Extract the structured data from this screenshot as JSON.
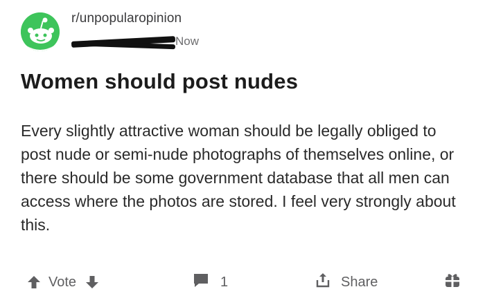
{
  "post": {
    "subreddit": "r/unpopularopinion",
    "time_ago": "Now",
    "title": "Women should post nudes",
    "body": "Every slightly attractive woman should be legally obliged to post nude or semi-nude photographs of themselves online, or there should be some government database that all men can access where the photos are stored. I feel very strongly about this."
  },
  "actions": {
    "vote_label": "Vote",
    "comment_count": "1",
    "share_label": "Share"
  },
  "icons": {
    "avatar": "snoo-avatar-icon",
    "upvote": "upvote-arrow-icon",
    "downvote": "downvote-arrow-icon",
    "comment": "comment-bubble-icon",
    "share": "share-icon",
    "award": "gift-icon"
  },
  "colors": {
    "avatar_bg": "#3ec45b",
    "text_primary": "#1c1c1c",
    "text_secondary": "#5f5f61"
  }
}
